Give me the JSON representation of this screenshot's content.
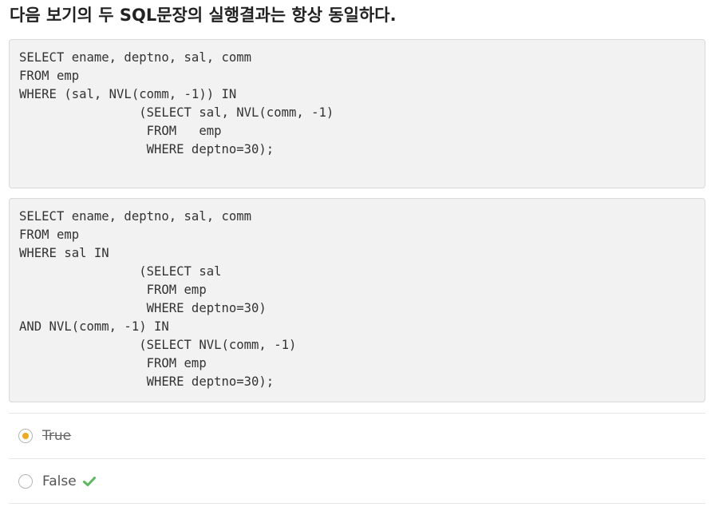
{
  "question": {
    "title": "다음 보기의 두 SQL문장의 실행결과는 항상 동일하다."
  },
  "code_blocks": [
    {
      "lines": [
        "SELECT ename, deptno, sal, comm",
        "FROM emp",
        "WHERE (sal, NVL(comm, -1)) IN",
        "                (SELECT sal, NVL(comm, -1)",
        "                 FROM   emp",
        "                 WHERE deptno=30);"
      ]
    },
    {
      "lines": [
        "SELECT ename, deptno, sal, comm",
        "FROM emp",
        "WHERE sal IN",
        "                (SELECT sal",
        "                 FROM emp",
        "                 WHERE deptno=30)",
        "AND NVL(comm, -1) IN",
        "                (SELECT NVL(comm, -1)",
        "                 FROM emp",
        "                 WHERE deptno=30);"
      ]
    }
  ],
  "options": [
    {
      "label": "True",
      "selected": true,
      "struck_through": true,
      "correct": false
    },
    {
      "label": "False",
      "selected": false,
      "struck_through": false,
      "correct": true
    }
  ],
  "colors": {
    "selected_radio": "#f0a81c",
    "correct_check": "#5cb85c",
    "code_background": "#f2f2f2"
  },
  "icons": {
    "correct": "check-icon"
  }
}
